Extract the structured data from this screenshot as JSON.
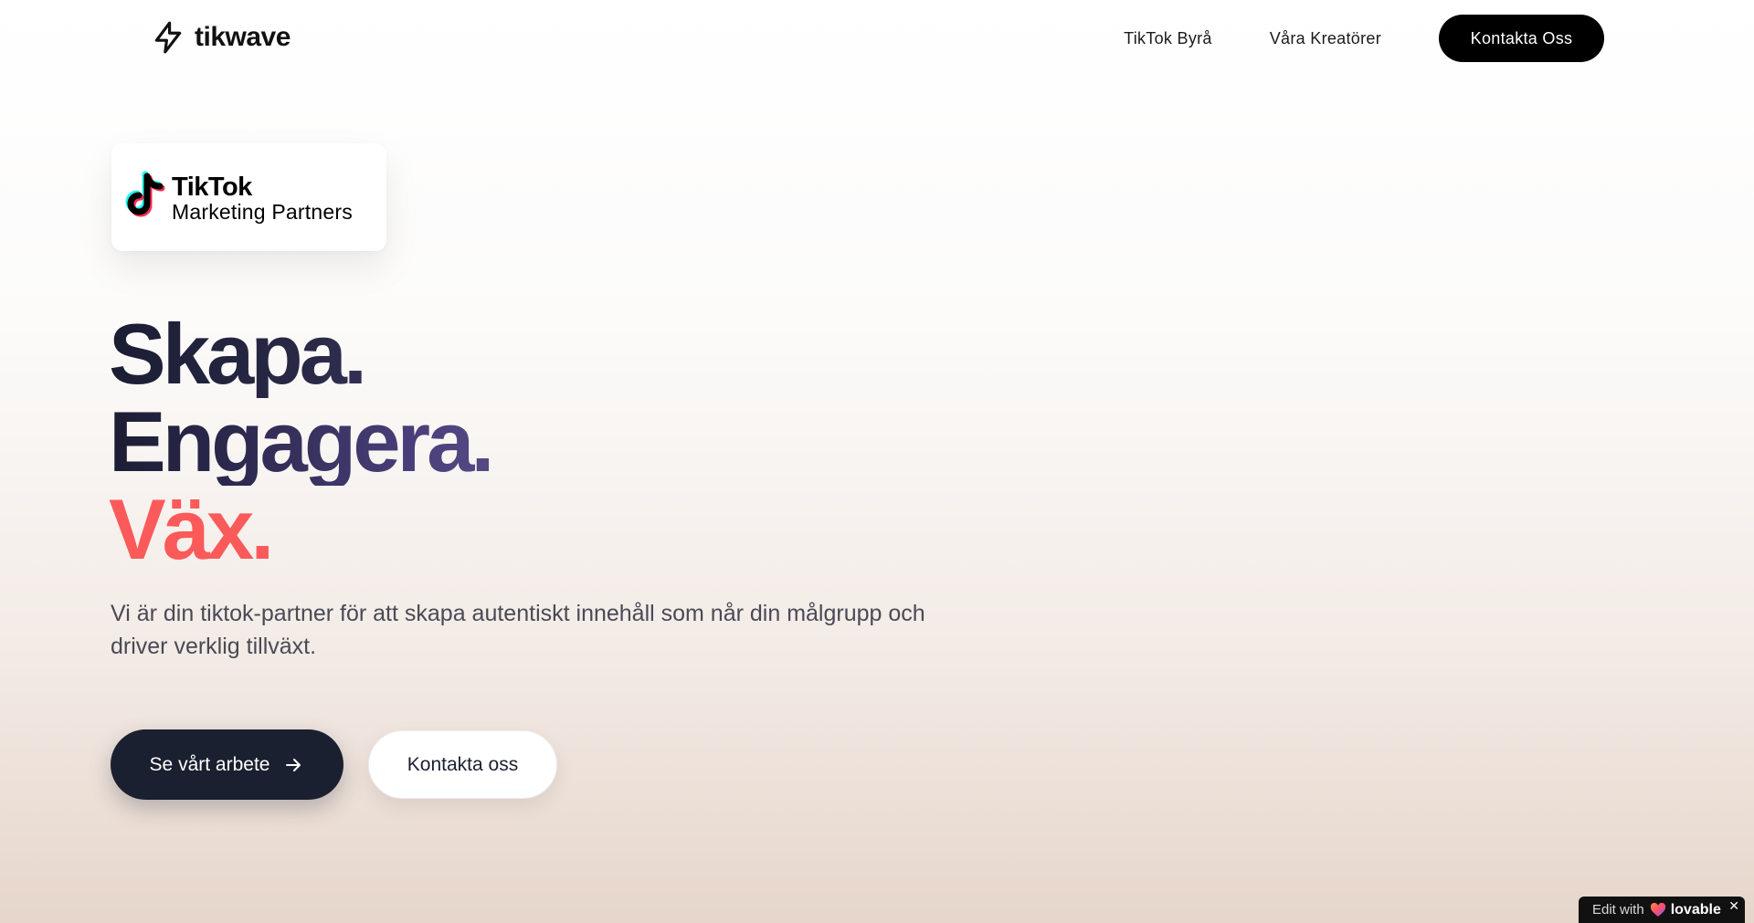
{
  "header": {
    "logo_text": "tikwave",
    "logo_icon": "lightning-bolt-icon",
    "nav": {
      "link_1": "TikTok Byrå",
      "link_2": "Våra Kreatörer",
      "cta": "Kontakta Oss"
    }
  },
  "badge": {
    "brand": "TikTok",
    "subtitle": "Marketing Partners",
    "icon": "tiktok-note-icon"
  },
  "hero": {
    "line1": "Skapa.",
    "line2": "Engagera.",
    "line3": "Väx.",
    "description": "Vi är din tiktok-partner för att skapa autentiskt innehåll som når din målgrupp och driver verklig tillväxt.",
    "primary_button": "Se vårt arbete",
    "secondary_button": "Kontakta oss"
  },
  "lovable": {
    "prefix": "Edit with",
    "brand": "lovable",
    "close": "✕"
  },
  "colors": {
    "accent_coral": "#fb5a5a",
    "dark_navy": "#1b2030",
    "purple": "#4a3f7a"
  }
}
